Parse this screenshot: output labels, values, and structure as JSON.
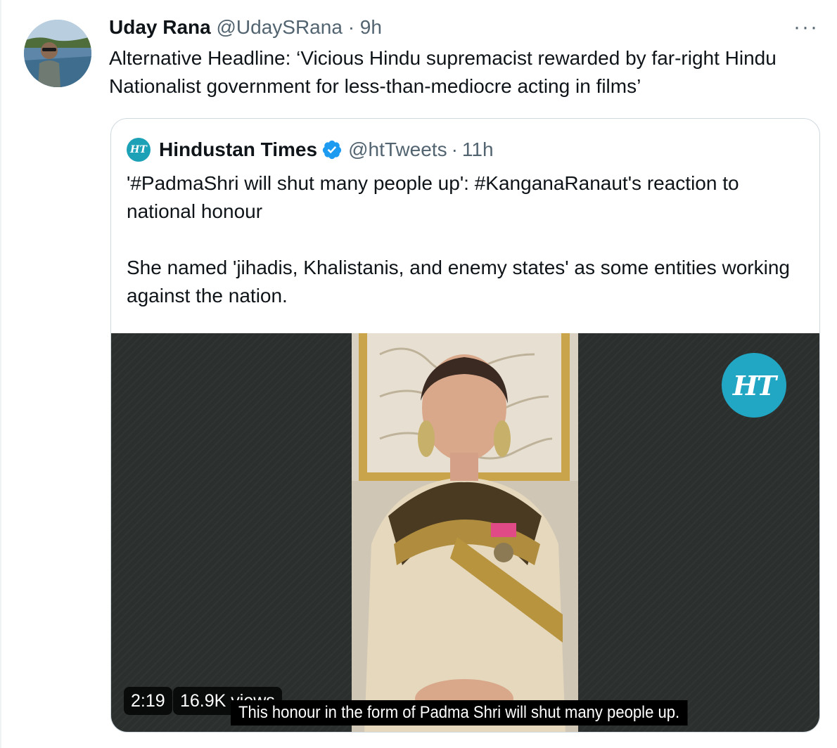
{
  "tweet": {
    "author_name": "Uday Rana",
    "author_handle": "@UdaySRana",
    "separator": "·",
    "time": "9h",
    "more_label": "···",
    "text": "Alternative Headline: ‘Vicious Hindu supremacist rewarded by far-right Hindu Nationalist government for less-than-mediocre acting in films’"
  },
  "quote": {
    "logo_text": "HT",
    "author_name": "Hindustan Times",
    "verified": true,
    "author_handle": "@htTweets",
    "separator": "·",
    "time": "11h",
    "text": "'#PadmaShri will shut many people up': #KanganaRanaut's reaction to national honour\n\nShe named 'jihadis, Khalistanis, and enemy states' as some entities working against the nation.",
    "media": {
      "badge_text": "HT",
      "duration": "2:19",
      "views": "16.9K views",
      "caption": "This honour in the form of Padma Shri will shut many people up."
    }
  },
  "colors": {
    "text_primary": "#0f1419",
    "text_secondary": "#536471",
    "border": "#cfd9de",
    "verified_blue": "#1d9bf0",
    "ht_teal": "#21a6c4"
  }
}
